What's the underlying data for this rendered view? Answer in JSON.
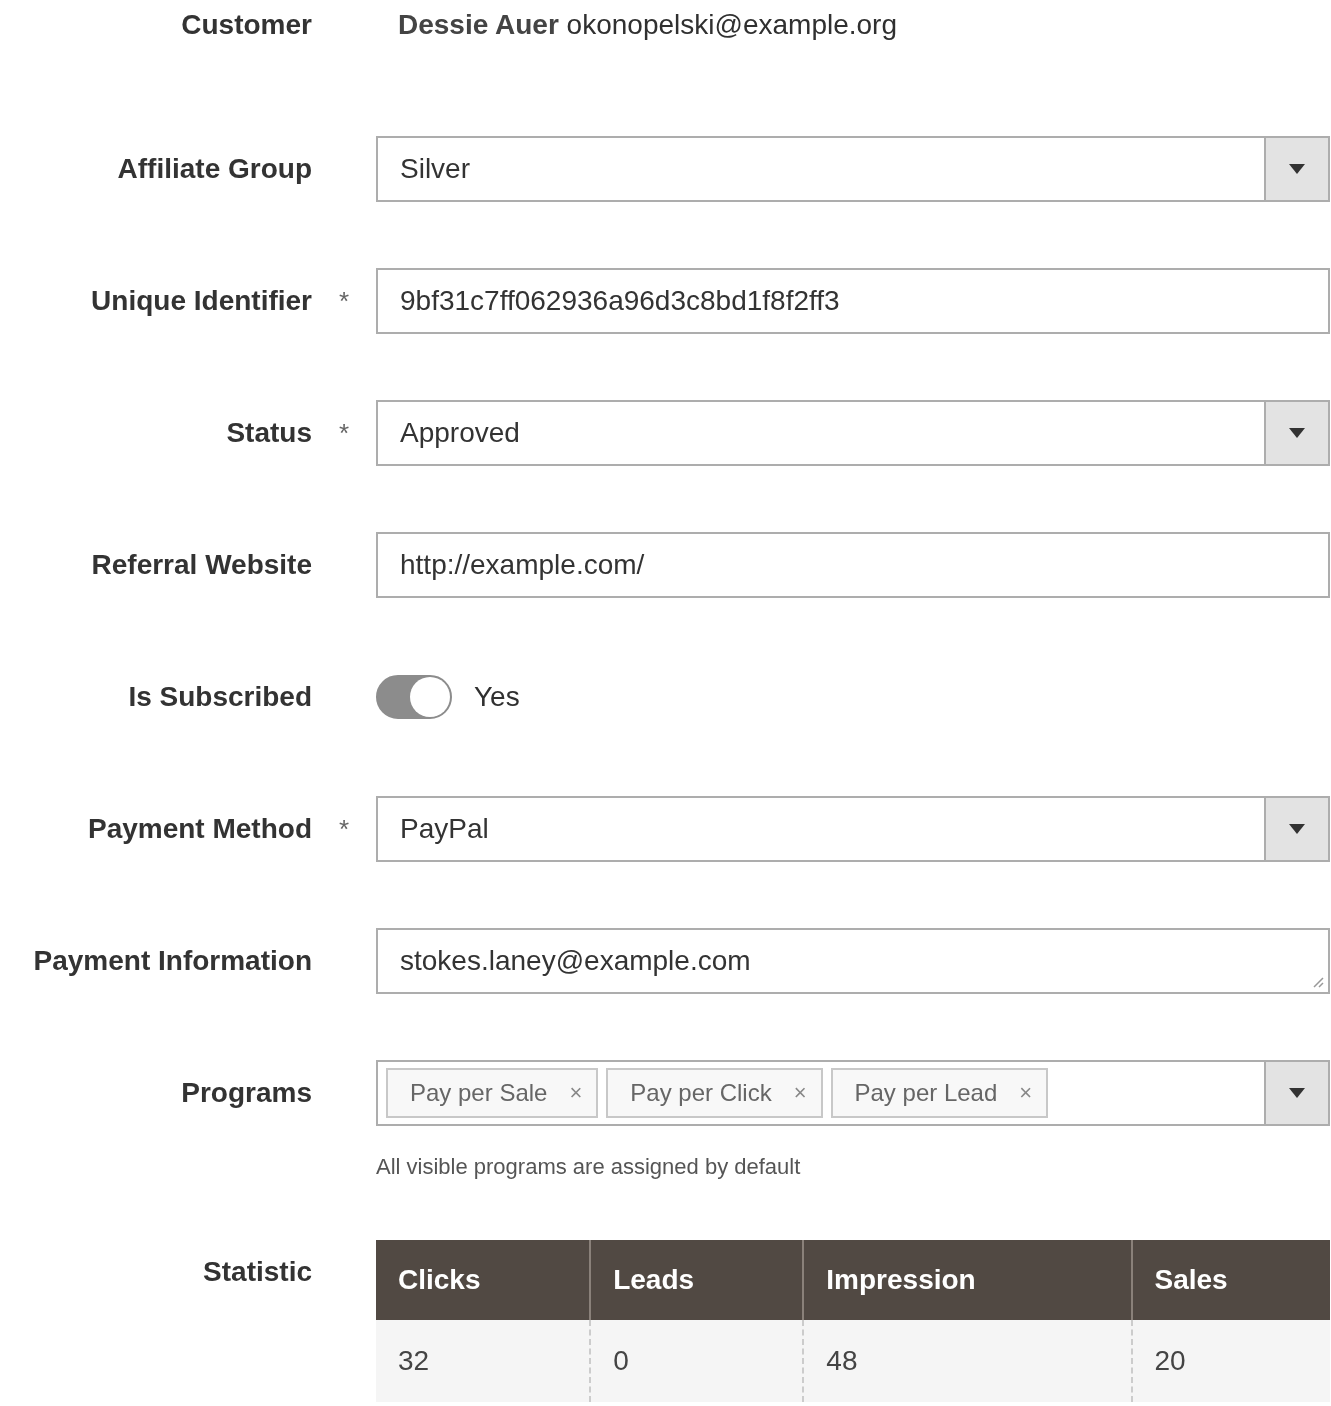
{
  "customer": {
    "label": "Customer",
    "name": "Dessie Auer",
    "email": "okonopelski@example.org"
  },
  "fields": [
    {
      "kind": "select",
      "label": "Affiliate Group",
      "value": "Silver"
    },
    {
      "kind": "text",
      "label": "Unique Identifier",
      "required_mark": "*",
      "value": "9bf31c7ff062936a96d3c8bd1f8f2ff3"
    },
    {
      "kind": "select",
      "label": "Status",
      "required_mark": "*",
      "value": "Approved"
    },
    {
      "kind": "text",
      "label": "Referral Website",
      "value": "http://example.com/"
    },
    {
      "kind": "toggle",
      "label": "Is Subscribed",
      "on": true,
      "value": "Yes"
    },
    {
      "kind": "select",
      "label": "Payment Method",
      "required_mark": "*",
      "value": "PayPal"
    },
    {
      "kind": "textarea",
      "label": "Payment Information",
      "value": "stokes.laney@example.com"
    },
    {
      "kind": "multiselect",
      "label": "Programs",
      "tags": [
        {
          "label": "Pay per Sale",
          "remove": "×"
        },
        {
          "label": "Pay per Click",
          "remove": "×"
        },
        {
          "label": "Pay per Lead",
          "remove": "×"
        }
      ],
      "note": "All visible programs are assigned by default"
    }
  ],
  "statistic": {
    "label": "Statistic",
    "columns": [
      "Clicks",
      "Leads",
      "Impression",
      "Sales"
    ],
    "rows": [
      [
        "32",
        "0",
        "48",
        "20"
      ]
    ]
  }
}
